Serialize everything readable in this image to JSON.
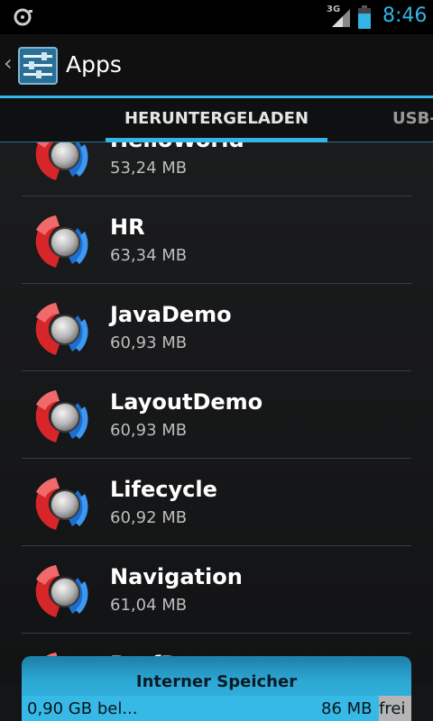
{
  "status_bar": {
    "network": "3G",
    "time": "8:46"
  },
  "action_bar": {
    "title": "Apps"
  },
  "tabs": [
    {
      "label": "HERUNTERGELADEN",
      "selected": true
    },
    {
      "label": "USB-"
    }
  ],
  "apps": [
    {
      "name": "HelloWorld",
      "size": "53,24 MB"
    },
    {
      "name": "HR",
      "size": "63,34 MB"
    },
    {
      "name": "JavaDemo",
      "size": "60,93 MB"
    },
    {
      "name": "LayoutDemo",
      "size": "60,93 MB"
    },
    {
      "name": "Lifecycle",
      "size": "60,92 MB"
    },
    {
      "name": "Navigation",
      "size": "61,04 MB"
    },
    {
      "name": "ProfDemo",
      "size": ""
    }
  ],
  "storage": {
    "label": "Interner Speicher",
    "used": "0,90 GB bel...",
    "free": "86 MB",
    "free_label": "frei"
  },
  "colors": {
    "accent": "#33b5e5",
    "background": "#141516"
  }
}
